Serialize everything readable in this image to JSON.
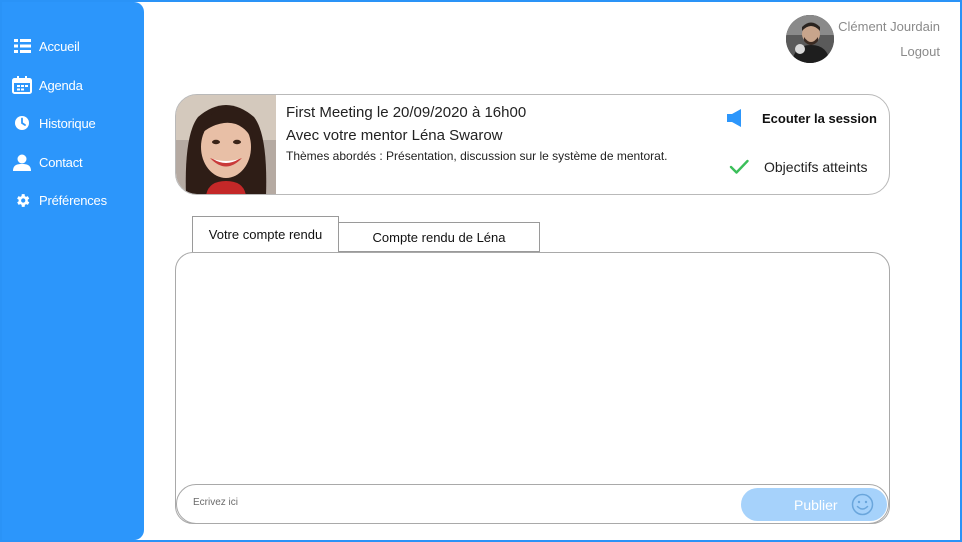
{
  "sidebar": {
    "items": [
      {
        "label": "Accueil",
        "icon": "grid-list-icon"
      },
      {
        "label": "Agenda",
        "icon": "calendar-icon"
      },
      {
        "label": "Historique",
        "icon": "clock-icon"
      },
      {
        "label": "Contact",
        "icon": "person-icon"
      },
      {
        "label": "Préférences",
        "icon": "gear-icon"
      }
    ]
  },
  "user": {
    "name": "Clément Jourdain",
    "logout_label": "Logout"
  },
  "meeting": {
    "title": "First Meeting le 20/09/2020 à 16h00",
    "mentor_line": "Avec votre mentor Léna Swarow",
    "themes": "Thèmes abordés : Présentation, discussion sur le système de mentorat.",
    "listen_label": "Ecouter la session",
    "goals_label": "Objectifs atteints"
  },
  "tabs": [
    {
      "label": "Votre compte rendu",
      "active": true
    },
    {
      "label": "Compte rendu de Léna",
      "active": false
    }
  ],
  "compose": {
    "placeholder": "Ecrivez ici",
    "publish_label": "Publier"
  },
  "colors": {
    "sidebar": "#2c96fb",
    "publish_button": "#a6d2fb",
    "check": "#3bbf5a",
    "speaker": "#2c96fb"
  }
}
